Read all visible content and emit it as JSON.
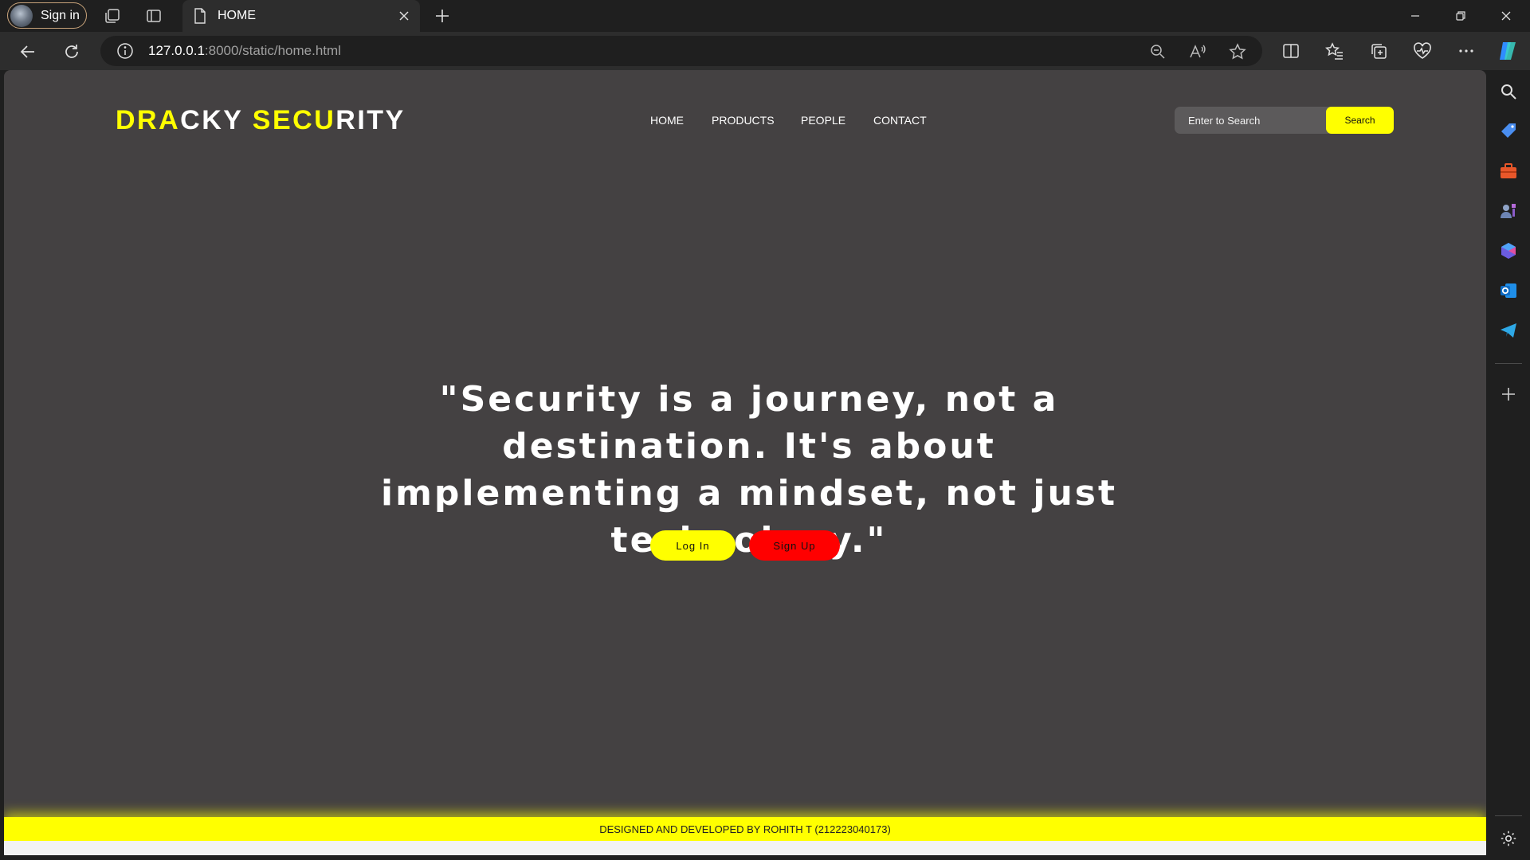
{
  "browser": {
    "profile_label": "Sign in",
    "tab_title": "HOME",
    "url_host": "127.0.0.1",
    "url_rest": ":8000/static/home.html"
  },
  "site": {
    "brand": {
      "part1": "DRA",
      "part2": "CKY ",
      "part3": "SECU",
      "part4": "RITY"
    },
    "nav": [
      "HOME",
      "PRODUCTS",
      "PEOPLE",
      "CONTACT"
    ],
    "search": {
      "placeholder": "Enter to Search",
      "button_label": "Search"
    },
    "quote": "\"Security is a journey, not a destination. It's about implementing a mindset, not just technology.\"",
    "login_label": "Log In",
    "signup_label": "Sign Up",
    "footer": "DESIGNED AND DEVELOPED BY ROHITH T (212223040173)"
  },
  "colors": {
    "accent": "#ffff00",
    "signup": "#ff0000",
    "page_bg": "#444142"
  }
}
